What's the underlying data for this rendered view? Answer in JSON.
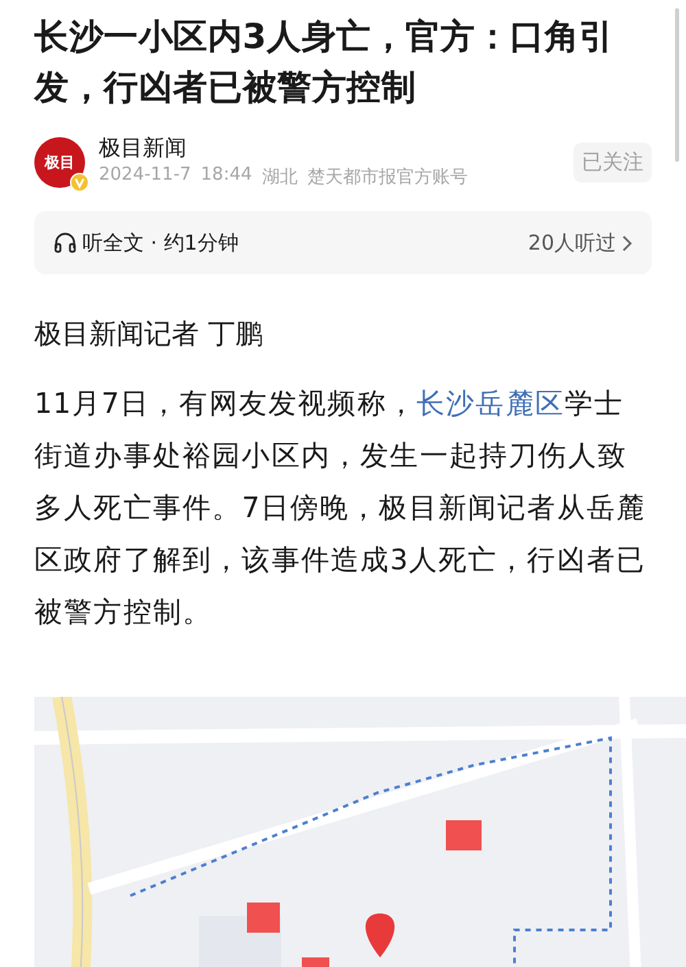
{
  "article": {
    "title": "长沙一小区内3人身亡，官方：口角引发，行凶者已被警方控制",
    "source": {
      "logo_text": "极目",
      "verified": true,
      "name": "极目新闻",
      "date": "2024-11-7",
      "time": "18:44",
      "region": "湖北",
      "account": "楚天都市报官方账号",
      "follow_button": "已关注",
      "followed": true
    },
    "listen_bar": {
      "label": "听全文 · 约1分钟",
      "listeners": "20人听过"
    },
    "byline": "极目新闻记者 丁鹏",
    "paragraph": [
      {
        "kind": "plain",
        "text": "11月7日，有网友发视频称，"
      },
      {
        "kind": "link",
        "text": "长沙岳麓区"
      },
      {
        "kind": "plain",
        "text": "学士街道办事处裕园小区内，发生一起持刀伤人致多人死亡事件。7日傍晚，极目新闻记者从岳麓区政府了解到，该事件造成3人死亡，行凶者已被警方控制。"
      }
    ]
  }
}
